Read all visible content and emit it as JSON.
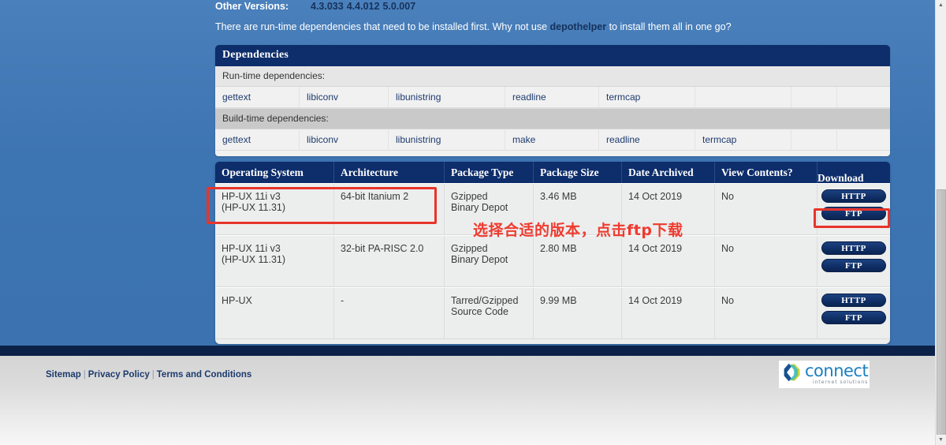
{
  "other_versions": {
    "label": "Other Versions:",
    "versions": [
      "4.3.033",
      "4.4.012",
      "5.0.007"
    ]
  },
  "intro": {
    "before": "There are run-time dependencies that need to be installed first. Why not use ",
    "link": "depothelper",
    "after": " to install them all in one go?"
  },
  "dependencies": {
    "title": "Dependencies",
    "runtime_label": "Run-time dependencies:",
    "runtime": [
      "gettext",
      "libiconv",
      "libunistring",
      "readline",
      "termcap",
      "",
      "",
      ""
    ],
    "buildtime_label": "Build-time dependencies:",
    "buildtime": [
      "gettext",
      "libiconv",
      "libunistring",
      "make",
      "readline",
      "termcap",
      "",
      ""
    ]
  },
  "downloads": {
    "columns": [
      "Operating System",
      "Architecture",
      "Package Type",
      "Package Size",
      "Date Archived",
      "View Contents?",
      "Download"
    ],
    "rows": [
      {
        "os_line1": "HP-UX 11i v3",
        "os_line2": "(HP-UX 11.31)",
        "arch": "64-bit Itanium 2",
        "pkg_line1": "Gzipped",
        "pkg_line2": "Binary Depot",
        "size": "3.46 MB",
        "date": "14 Oct 2019",
        "view": "No",
        "http_label": "HTTP",
        "ftp_label": "FTP"
      },
      {
        "os_line1": "HP-UX 11i v3",
        "os_line2": "(HP-UX 11.31)",
        "arch": "32-bit PA-RISC 2.0",
        "pkg_line1": "Gzipped",
        "pkg_line2": "Binary Depot",
        "size": "2.80 MB",
        "date": "14 Oct 2019",
        "view": "No",
        "http_label": "HTTP",
        "ftp_label": "FTP"
      },
      {
        "os_line1": "HP-UX",
        "os_line2": "",
        "arch": "-",
        "pkg_line1": "Tarred/Gzipped",
        "pkg_line2": "Source Code",
        "size": "9.99 MB",
        "date": "14 Oct 2019",
        "view": "No",
        "http_label": "HTTP",
        "ftp_label": "FTP"
      }
    ]
  },
  "annotations": {
    "note": "选择合适的版本，点击ftp下载",
    "color": "#ef3b30"
  },
  "footer": {
    "links": [
      "Sitemap",
      "Privacy Policy",
      "Terms and Conditions"
    ],
    "separator": "|",
    "logo_word": "connect",
    "logo_sub": "internet solutions"
  },
  "scrollbar": {
    "up_arrow": "▲",
    "down_arrow": "▼"
  },
  "theme": {
    "page_blue": "#3d74b2",
    "panel_navy": "#0d2d6b",
    "link_navy": "#16325c",
    "accent_red": "#e8342a"
  }
}
